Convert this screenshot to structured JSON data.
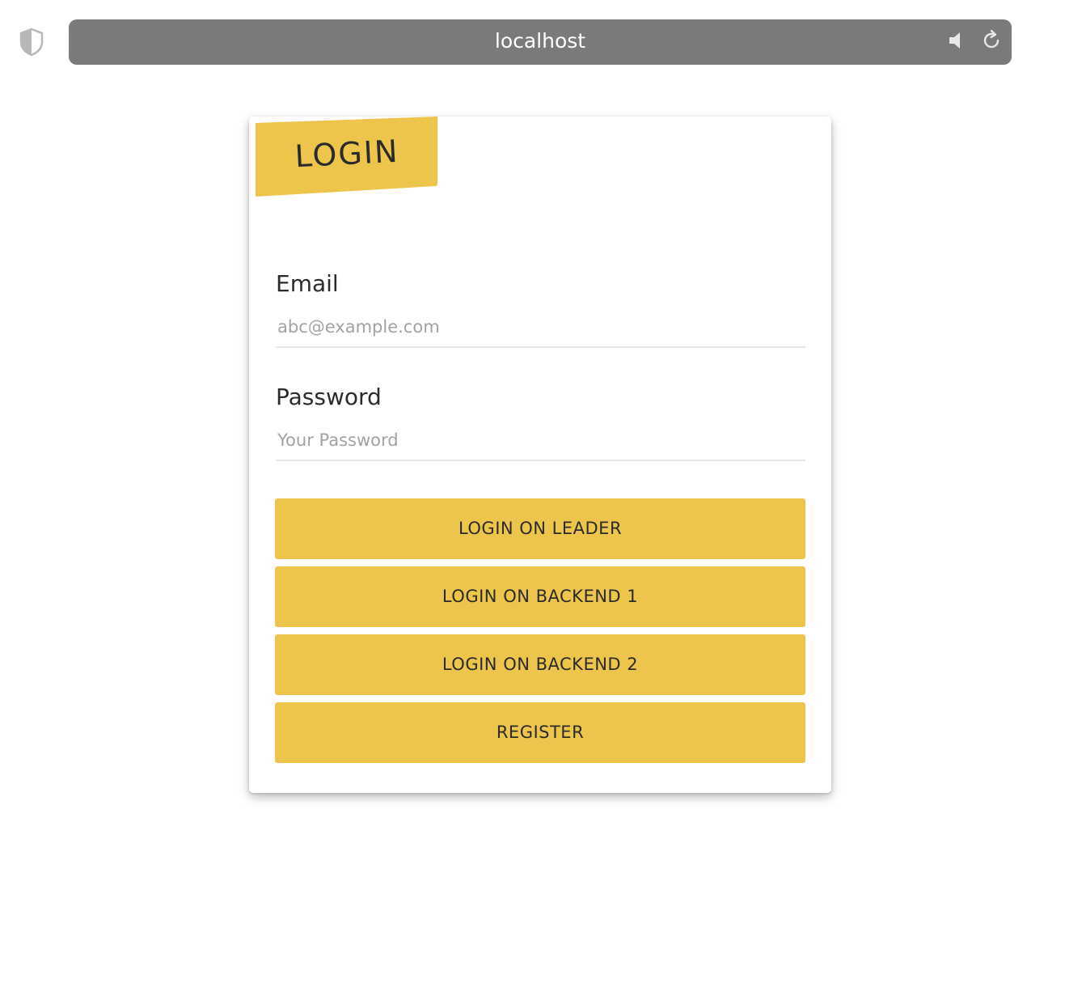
{
  "browser": {
    "url": "localhost",
    "icons": [
      "shield-icon",
      "speaker-icon",
      "reload-icon"
    ]
  },
  "login_card": {
    "title": "LOGIN",
    "email": {
      "label": "Email",
      "placeholder": "abc@example.com",
      "value": ""
    },
    "password": {
      "label": "Password",
      "placeholder": "Your Password",
      "value": ""
    },
    "buttons": {
      "leader": "LOGIN ON LEADER",
      "backend1": "LOGIN ON BACKEND 1",
      "backend2": "LOGIN ON BACKEND 2",
      "register": "REGISTER"
    }
  },
  "colors": {
    "accent": "#edc54c",
    "url_bar": "#7a7a7a",
    "text": "#2b2b2b",
    "placeholder": "#a3a3a3"
  }
}
